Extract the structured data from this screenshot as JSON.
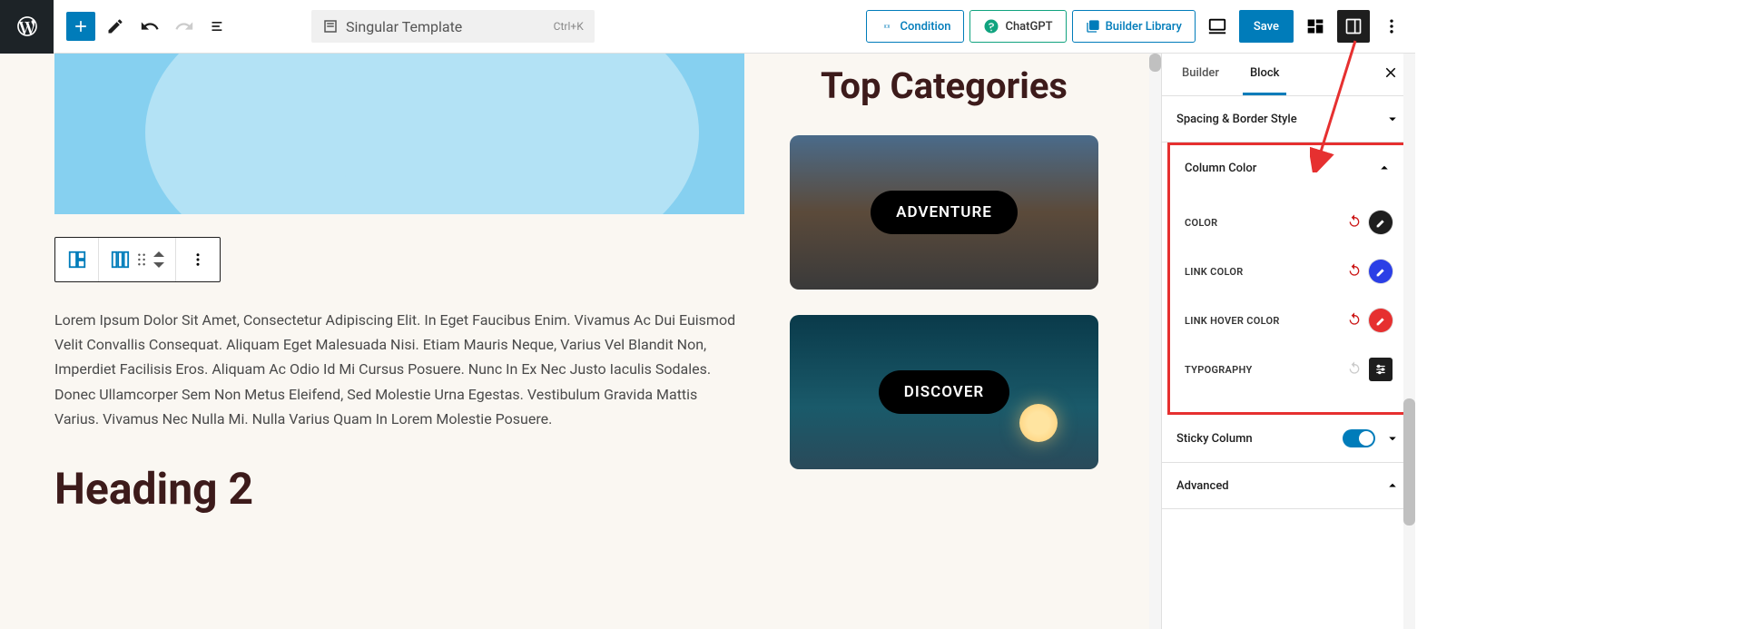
{
  "topbar": {
    "cmd_label": "Singular Template",
    "cmd_kbd": "Ctrl+K",
    "condition": "Condition",
    "chatgpt": "ChatGPT",
    "library": "Builder Library",
    "save": "Save"
  },
  "canvas": {
    "paragraph": "Lorem Ipsum Dolor Sit Amet, Consectetur Adipiscing Elit. In Eget Faucibus Enim. Vivamus Ac Dui Euismod Velit Convallis Consequat. Aliquam Eget Malesuada Nisi. Etiam Mauris Neque, Varius Vel Blandit Non, Imperdiet Facilisis Eros. Aliquam Ac Odio Id Mi Cursus Posuere. Nunc In Ex Nec Justo Iaculis Sodales. Donec Ullamcorper Sem Non Metus Eleifend, Sed Molestie Urna Egestas. Vestibulum Gravida Mattis Varius. Vivamus Nec Nulla Mi. Nulla Varius Quam In Lorem Molestie Posuere.",
    "heading": "Heading 2",
    "right_heading": "Top Categories",
    "cat1": "ADVENTURE",
    "cat2": "DISCOVER"
  },
  "sidebar": {
    "tab_builder": "Builder",
    "tab_block": "Block",
    "panel_spacing": "Spacing & Border Style",
    "panel_color": "Column Color",
    "color_label": "COLOR",
    "link_color_label": "LINK COLOR",
    "link_hover_label": "LINK HOVER COLOR",
    "typography_label": "TYPOGRAPHY",
    "sticky_label": "Sticky Column",
    "advanced_label": "Advanced",
    "swatches": {
      "color": "#1e1e1e",
      "link": "#2b3fe6",
      "hover": "#e63030"
    }
  }
}
